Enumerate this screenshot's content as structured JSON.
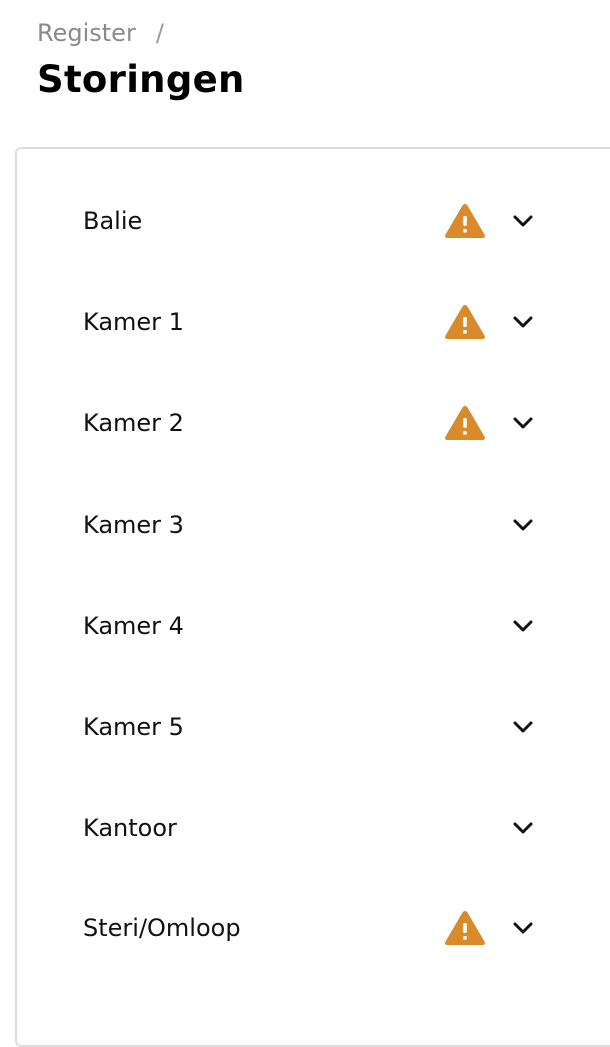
{
  "breadcrumb": {
    "parent": "Register",
    "separator": "/"
  },
  "page": {
    "title": "Storingen"
  },
  "colors": {
    "warning": "#D98A2B",
    "chevron": "#111111"
  },
  "locations": [
    {
      "label": "Balie",
      "warning": true,
      "expanded": false
    },
    {
      "label": "Kamer 1",
      "warning": true,
      "expanded": false
    },
    {
      "label": "Kamer 2",
      "warning": true,
      "expanded": false
    },
    {
      "label": "Kamer 3",
      "warning": false,
      "expanded": false
    },
    {
      "label": "Kamer 4",
      "warning": false,
      "expanded": false
    },
    {
      "label": "Kamer 5",
      "warning": false,
      "expanded": false
    },
    {
      "label": "Kantoor",
      "warning": false,
      "expanded": false
    },
    {
      "label": "Steri/Omloop",
      "warning": true,
      "expanded": false
    }
  ],
  "icons": {
    "warning": "warning-triangle-icon",
    "expand": "chevron-down-icon"
  }
}
